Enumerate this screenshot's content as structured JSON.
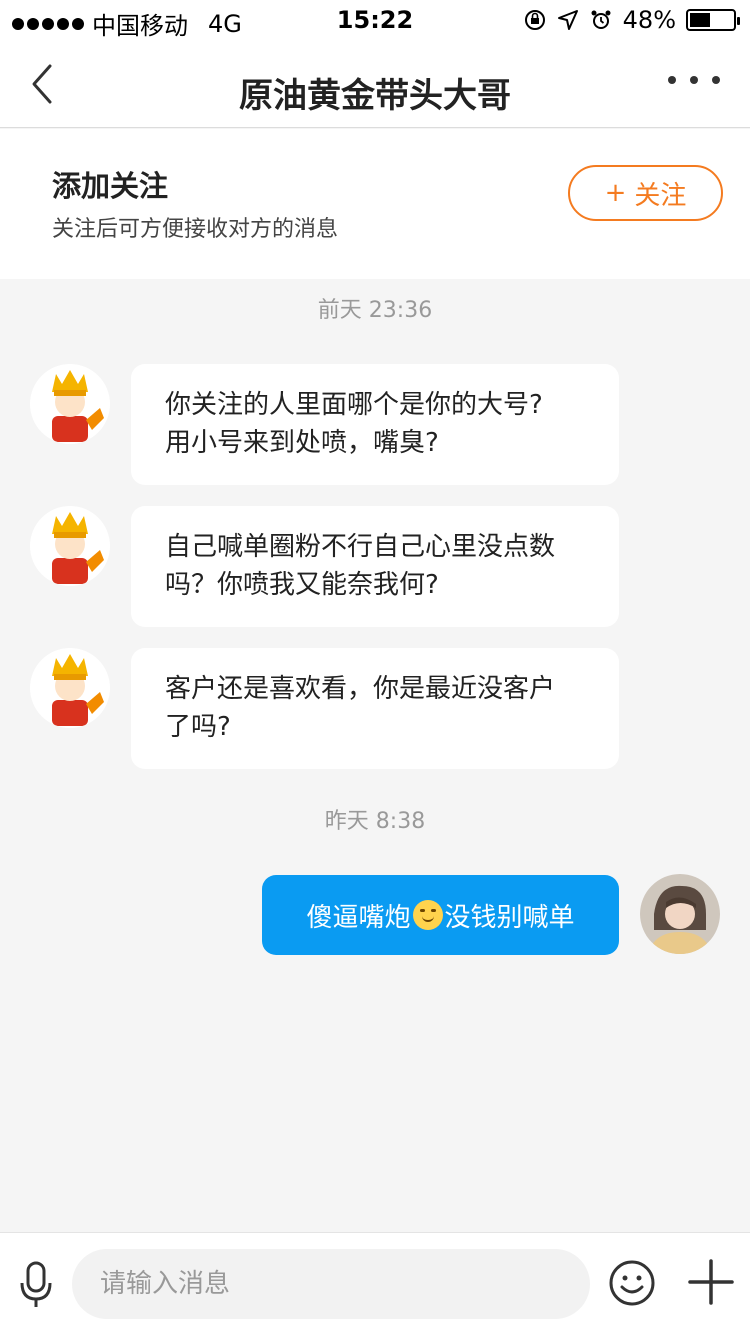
{
  "status_bar": {
    "carrier": "中国移动",
    "network": "4G",
    "time": "15:22",
    "battery_text": "48%",
    "battery_level": 0.48
  },
  "nav": {
    "title": "原油黄金带头大哥",
    "back_icon": "chevron-left-icon",
    "more_icon": "more-dots-icon"
  },
  "follow_panel": {
    "title": "添加关注",
    "subtitle": "关注后可方便接收对方的消息",
    "button_label": "关注",
    "button_color": "#f47b20"
  },
  "chat": {
    "timestamp_1": "前天 23:36",
    "incoming": [
      {
        "line1": "你关注的人里面哪个是你的大号?",
        "line2": "用小号来到处喷，嘴臭?"
      },
      {
        "line1": "自己喊单圈粉不行自己心里没点数",
        "line2": "吗？你喷我又能奈我何?"
      },
      {
        "line1": "客户还是喜欢看，你是最近没客户",
        "line2": "了吗?"
      }
    ],
    "timestamp_2": "昨天 8:38",
    "outgoing": {
      "before_emoji": "傻逼嘴炮",
      "after_emoji": "没钱别喊单",
      "bubble_color": "#0a9bf2"
    }
  },
  "input_bar": {
    "placeholder": "请输入消息",
    "mic_icon": "microphone-icon",
    "emoji_icon": "smiley-icon",
    "plus_icon": "plus-icon"
  }
}
